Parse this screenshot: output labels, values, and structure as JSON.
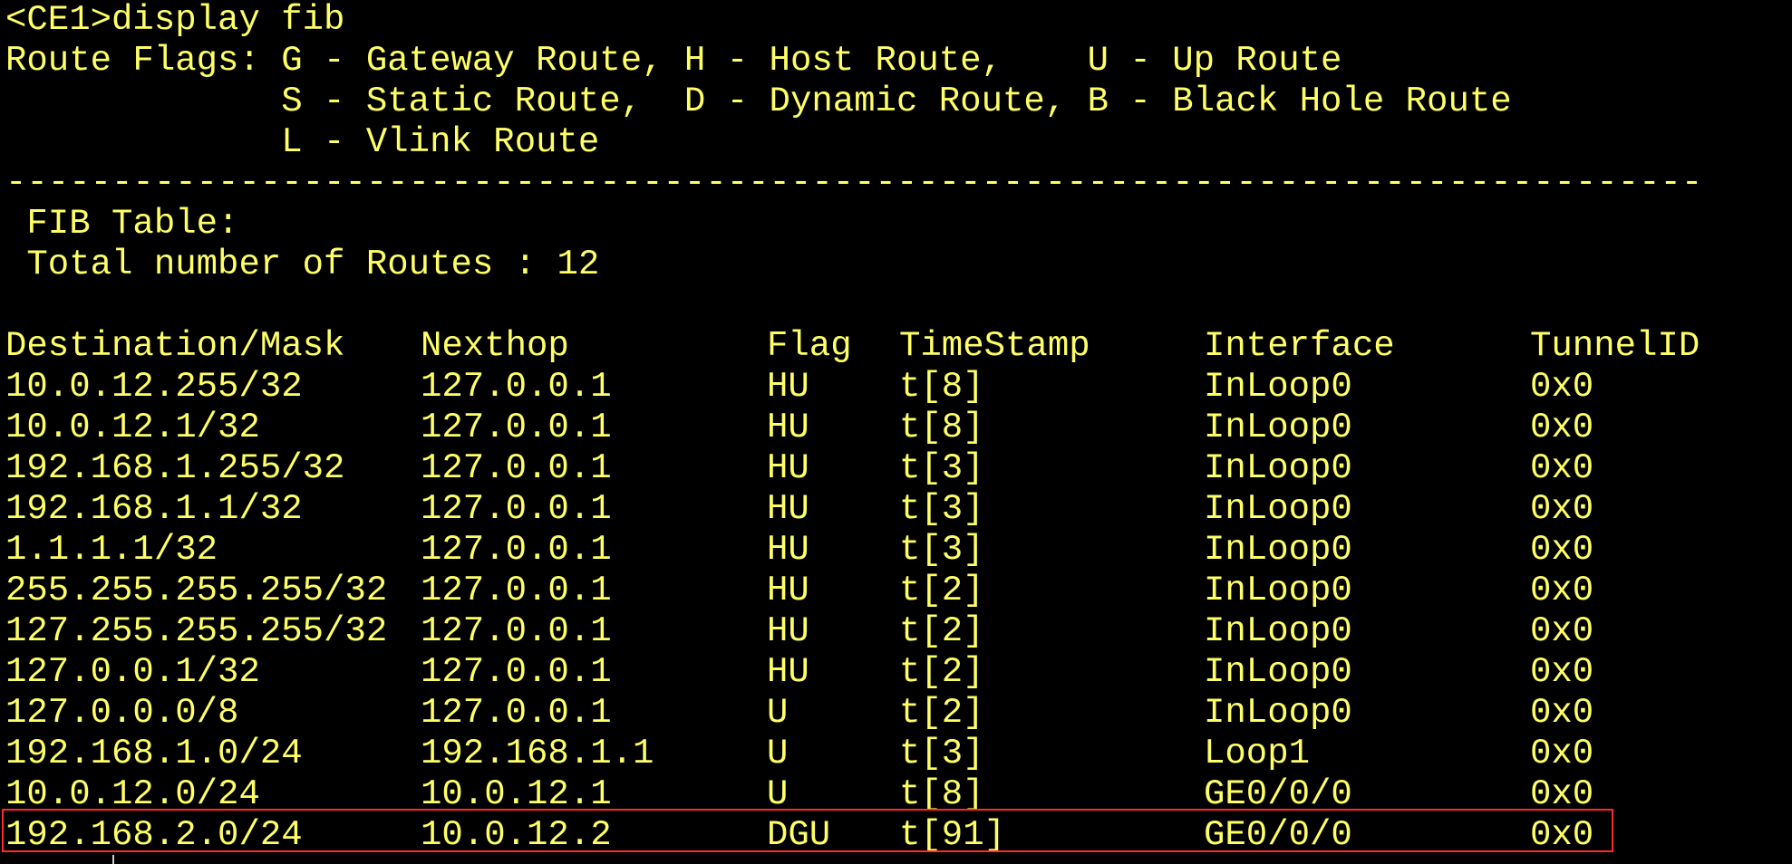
{
  "terminal": {
    "prompt_line": "<CE1>display fib",
    "flags_lines": [
      "Route Flags: G - Gateway Route, H - Host Route,    U - Up Route",
      "             S - Static Route,  D - Dynamic Route, B - Black Hole Route",
      "             L - Vlink Route"
    ],
    "separator": "--------------------------------------------------------------------------------",
    "fib_title": " FIB Table:",
    "total_routes": " Total number of Routes : 12"
  },
  "fib": {
    "headers": {
      "destination": "Destination/Mask",
      "nexthop": "Nexthop",
      "flag": "Flag",
      "timestamp": "TimeStamp",
      "interface": "Interface",
      "tunnel": "TunnelID"
    },
    "rows": [
      {
        "destination": "10.0.12.255/32",
        "nexthop": "127.0.0.1",
        "flag": "HU",
        "timestamp": "t[8]",
        "interface": "InLoop0",
        "tunnel": "0x0"
      },
      {
        "destination": "10.0.12.1/32",
        "nexthop": "127.0.0.1",
        "flag": "HU",
        "timestamp": "t[8]",
        "interface": "InLoop0",
        "tunnel": "0x0"
      },
      {
        "destination": "192.168.1.255/32",
        "nexthop": "127.0.0.1",
        "flag": "HU",
        "timestamp": "t[3]",
        "interface": "InLoop0",
        "tunnel": "0x0"
      },
      {
        "destination": "192.168.1.1/32",
        "nexthop": "127.0.0.1",
        "flag": "HU",
        "timestamp": "t[3]",
        "interface": "InLoop0",
        "tunnel": "0x0"
      },
      {
        "destination": "1.1.1.1/32",
        "nexthop": "127.0.0.1",
        "flag": "HU",
        "timestamp": "t[3]",
        "interface": "InLoop0",
        "tunnel": "0x0"
      },
      {
        "destination": "255.255.255.255/32",
        "nexthop": "127.0.0.1",
        "flag": "HU",
        "timestamp": "t[2]",
        "interface": "InLoop0",
        "tunnel": "0x0"
      },
      {
        "destination": "127.255.255.255/32",
        "nexthop": "127.0.0.1",
        "flag": "HU",
        "timestamp": "t[2]",
        "interface": "InLoop0",
        "tunnel": "0x0"
      },
      {
        "destination": "127.0.0.1/32",
        "nexthop": "127.0.0.1",
        "flag": "HU",
        "timestamp": "t[2]",
        "interface": "InLoop0",
        "tunnel": "0x0"
      },
      {
        "destination": "127.0.0.0/8",
        "nexthop": "127.0.0.1",
        "flag": "U",
        "timestamp": "t[2]",
        "interface": "InLoop0",
        "tunnel": "0x0"
      },
      {
        "destination": "192.168.1.0/24",
        "nexthop": "192.168.1.1",
        "flag": "U",
        "timestamp": "t[3]",
        "interface": "Loop1",
        "tunnel": "0x0"
      },
      {
        "destination": "10.0.12.0/24",
        "nexthop": "10.0.12.1",
        "flag": "U",
        "timestamp": "t[8]",
        "interface": "GE0/0/0",
        "tunnel": "0x0"
      },
      {
        "destination": "192.168.2.0/24",
        "nexthop": "10.0.12.2",
        "flag": "DGU",
        "timestamp": "t[91]",
        "interface": "GE0/0/0",
        "tunnel": "0x0"
      }
    ]
  },
  "colors": {
    "background": "#000000",
    "text": "#ffff66",
    "highlight_border": "#ff2a2a"
  }
}
